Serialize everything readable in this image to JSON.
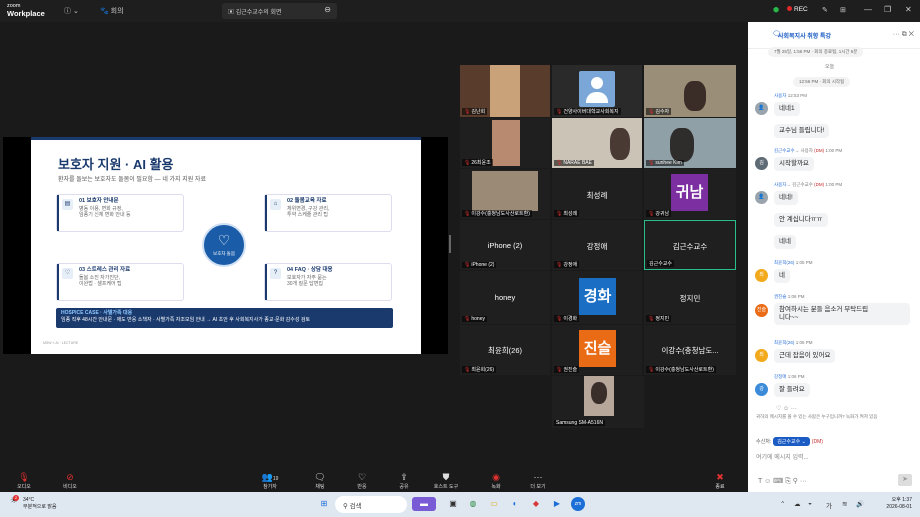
{
  "app": {
    "logo_line1": "zoom",
    "logo_line2": "Workplace",
    "menu_info": "ⓘ ⌄",
    "menu_user": "회의",
    "meeting_title": "김근수교수의 회면",
    "rec_label": "REC"
  },
  "slide": {
    "title": "보호자 지원 · AI 활용",
    "subtitle": "환자를 돌보는 보호자도 돌봄이 필요함 — 네 가지 지원 자료",
    "cards": [
      {
        "title": "01 보호자 안내문",
        "l1": "병동 이용, 면회 규정,",
        "l2": "임종기 신체 변화 안내 등"
      },
      {
        "title": "02 돌봄교육 자료",
        "l1": "체위변경, 구강 관리,",
        "l2": "투약 스케줄 관리 팁"
      },
      {
        "title": "03 스트레스 관리 자료",
        "l1": "돌봄 소진 자가진단,",
        "l2": "이완법 · 셀프케어 팁"
      },
      {
        "title": "04 FAQ · 상담 대응",
        "l1": "보호자가 자주 묻는",
        "l2": "30개 질문 답변집"
      }
    ],
    "hub_label": "보호자 돌봄",
    "hospice_title": "HOSPICE CASE · 사별가족 대응",
    "hospice_text": "임종 직후 48시간 안내문 · 애도 반응 소책자 · 사별가족 자조모임 안내 → AI 초안 후 사회복지사가 종교·문화 감수성 검토",
    "footer": "MSW × AI · LECTURE"
  },
  "participants": {
    "t1": "김난희",
    "t2": "건양사이버대학교사회복지",
    "t3": "김수자",
    "t4": "26최윤조",
    "t5": "NARAE BAE",
    "t6": "sunhee Kim",
    "t7": "이강수(충청남도사산로트환)",
    "t8name": "최성례",
    "t8": "최성례",
    "t9chip": "귀남",
    "t9": "강귀남",
    "t10name": "iPhone (2)",
    "t10": "iPhone (2)",
    "t11name": "강정애",
    "t11": "강정애",
    "t12name": "김근수교수",
    "t12": "김근수교수",
    "t13name": "honey",
    "t13": "honey",
    "t14chip": "경화",
    "t14": "이경화",
    "t15name": "정지민",
    "t15": "정지민",
    "t16name": "최윤희(26)",
    "t16": "최윤희(26)",
    "t17chip": "진슬",
    "t17": "권진슬",
    "t18name": "이강수(충청남도...",
    "t18": "이강수(충청남도사산로트환)",
    "t19": "Samsung SM-A516N"
  },
  "chat": {
    "title": "사회복지사 취향 특강",
    "header_icons": "··· ⧉ ✕",
    "sys1": "7월 25일, 1:56 PM · 회의 종료됨, 1시간 6분",
    "today": "오늘",
    "sys2": "12:56 PM · 회의 시작됨",
    "m1_sender": "사용자",
    "m1_time": "12:53 PM",
    "m1a": "네네1",
    "m1b": "교수님 들립니다!",
    "m2_sender": "김근수교수",
    "m2_mid": "→ 사용자",
    "m2_dm": "(DM)",
    "m2_time": "1:00 PM",
    "m2_text": "시작할까요",
    "m3_sender": "사용자",
    "m3_mid": "→ 김근수교수",
    "m3_dm": "(DM)",
    "m3_time": "1:00 PM",
    "m3a": "네네!",
    "m3b": "안 계십니다ㅠㅠ",
    "m3c": "네네",
    "m4_sender": "최윤희(26)",
    "m4_time": "1:05 PM",
    "m4_text": "네",
    "m5_sender": "권진슬",
    "m5_time": "1:06 PM",
    "m5_line1": "참여하시는 분들 음소거 부탁드립",
    "m5_line2": "니다~~",
    "m6_sender": "최윤희(26)",
    "m6_time": "1:06 PM",
    "m6_text": "근데 잡음이 있어요",
    "m7_sender": "강정애",
    "m7_time": "1:06 PM",
    "m7_text": "잘 들려요",
    "notice": "귀하의 메시지를 볼 수 있는 사람은 누구입니까? 녹화가 켜져 있음",
    "to_label": "수신처:",
    "to_value": "김근수교수 ⌄",
    "to_dm": "(DM)",
    "input_placeholder": "여기에 메시지 입력...",
    "input_tools": "T  ☺  ⌨  ⎘  ⚲  ···"
  },
  "toolbar": {
    "audio": "오디오",
    "video": "비디오",
    "participants": "참가자",
    "participants_count": "19",
    "chat": "채팅",
    "react": "반응",
    "share": "공유",
    "host": "호스트 도구",
    "record": "녹화",
    "more": "더 보기",
    "end": "종료"
  },
  "taskbar": {
    "temp": "34°C",
    "weather": "부분적으로 맑음",
    "search": "검색",
    "time": "오후 1:37",
    "date": "2026-08-01",
    "ime": "가",
    "badge": "2"
  }
}
